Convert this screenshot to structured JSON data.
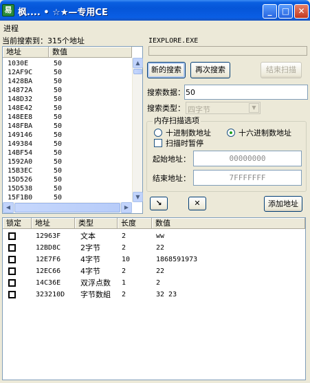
{
  "window": {
    "title": "枫.... • ☆★—专用CE",
    "icon_text": "易",
    "minimize": "_",
    "maximize": "□",
    "close": "✕"
  },
  "menu": {
    "process": "进程"
  },
  "search_status": "当前搜索到：315个地址",
  "process_name": "IEXPLORE.EXE",
  "results_table": {
    "columns": [
      "地址",
      "数值"
    ],
    "rows": [
      [
        "1030E",
        "50"
      ],
      [
        "12AF9C",
        "50"
      ],
      [
        "1428BA",
        "50"
      ],
      [
        "14872A",
        "50"
      ],
      [
        "148D32",
        "50"
      ],
      [
        "148E42",
        "50"
      ],
      [
        "148EE8",
        "50"
      ],
      [
        "148FBA",
        "50"
      ],
      [
        "149146",
        "50"
      ],
      [
        "149384",
        "50"
      ],
      [
        "14BF54",
        "50"
      ],
      [
        "1592A0",
        "50"
      ],
      [
        "15B3EC",
        "50"
      ],
      [
        "15D526",
        "50"
      ],
      [
        "15D538",
        "50"
      ],
      [
        "15F1B0",
        "50"
      ]
    ]
  },
  "buttons": {
    "new_scan": "新的搜索",
    "next_scan": "再次搜索",
    "end_scan": "结束扫描",
    "add_address": "添加地址",
    "scroll_down_icon": "↘",
    "clear_icon": "✕"
  },
  "search": {
    "data_label": "搜索数据：",
    "data_value": "50",
    "type_label": "搜索类型：",
    "type_value": "四字节"
  },
  "memory_options": {
    "title": "内存扫描选项",
    "decimal": "十进制数地址",
    "hex": "十六进制数地址",
    "pause": "扫描时暂停",
    "start_label": "起始地址：",
    "start_value": "00000000",
    "end_label": "结束地址：",
    "end_value": "7FFFFFFF"
  },
  "cheat_table": {
    "columns": [
      "锁定",
      "地址",
      "类型",
      "长度",
      "数值"
    ],
    "rows": [
      {
        "address": "12963F",
        "type": "文本",
        "length": "2",
        "value": "ww"
      },
      {
        "address": "12BD8C",
        "type": "2字节",
        "length": "2",
        "value": "22"
      },
      {
        "address": "12E7F6",
        "type": "4字节",
        "length": "10",
        "value": "1868591973"
      },
      {
        "address": "12EC66",
        "type": "4字节",
        "length": "2",
        "value": "22"
      },
      {
        "address": "14C36E",
        "type": "双浮点数",
        "length": "1",
        "value": "2"
      },
      {
        "address": "323210D",
        "type": "字节数組",
        "length": "2",
        "value": "32 23"
      }
    ]
  },
  "colors": {
    "titlebar": "#0555d8",
    "face": "#ece9d8",
    "border": "#7f9db9"
  }
}
